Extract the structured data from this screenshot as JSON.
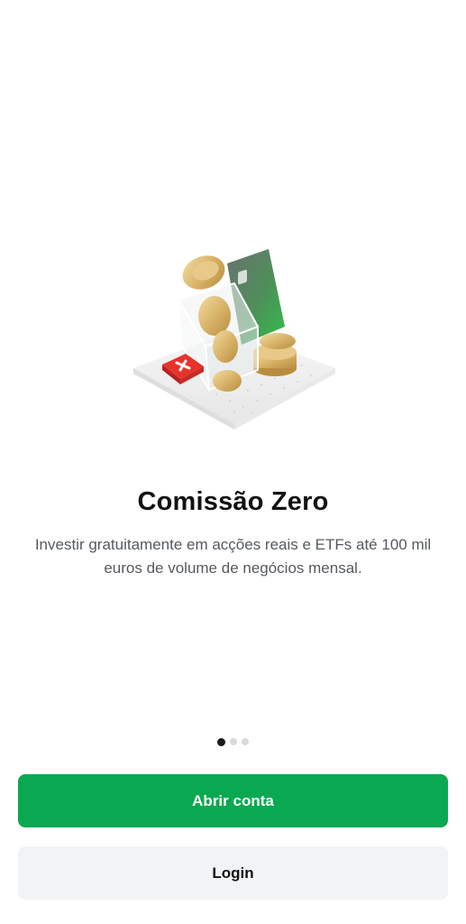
{
  "onboarding": {
    "title": "Comissão Zero",
    "description": "Investir gratuitamente em acções reais e ETFs até 100 mil euros de volume de negócios mensal.",
    "page_indicator": {
      "current": 1,
      "total": 3
    }
  },
  "actions": {
    "open_account_label": "Abrir conta",
    "login_label": "Login"
  },
  "colors": {
    "primary": "#0aa851",
    "secondary_bg": "#f2f3f5",
    "title": "#111111",
    "body_text": "#555a5f",
    "dot_active": "#1a1a1a",
    "dot_inactive": "#dadada"
  }
}
